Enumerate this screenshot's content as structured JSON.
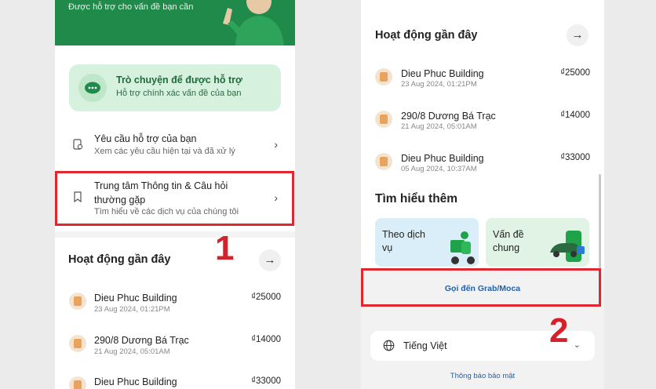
{
  "left": {
    "hero_subtitle": "Được hỗ trợ cho vấn đề bạn cần",
    "chat_card": {
      "title": "Trò chuyện để được hỗ trợ",
      "subtitle": "Hỗ trợ chính xác vấn đề của bạn"
    },
    "support_requests": {
      "title": "Yêu cầu hỗ trợ của bạn",
      "subtitle": "Xem các yêu cầu hiện tại và đã xử lý"
    },
    "help_center": {
      "title_line1": "Trung tâm Thông tin & Câu hỏi",
      "title_line2": "thường gặp",
      "subtitle": "Tìm hiểu về các dịch vụ của chúng tôi"
    },
    "step_number": "1",
    "recent_title": "Hoạt động gần đây",
    "activities": [
      {
        "name": "Dieu Phuc Building",
        "date": "23 Aug 2024, 01:21PM",
        "amount": "₫25000"
      },
      {
        "name": "290/8 Dương Bá Trạc",
        "date": "21 Aug 2024, 05:01AM",
        "amount": "₫14000"
      },
      {
        "name": "Dieu Phuc Building",
        "date": "",
        "amount": "₫33000"
      }
    ]
  },
  "right": {
    "recent_title": "Hoạt động gần đây",
    "activities": [
      {
        "name": "Dieu Phuc Building",
        "date": "23 Aug 2024, 01:21PM",
        "amount": "₫25000"
      },
      {
        "name": "290/8 Dương Bá Trạc",
        "date": "21 Aug 2024, 05:01AM",
        "amount": "₫14000"
      },
      {
        "name": "Dieu Phuc Building",
        "date": "05 Aug 2024, 10:37AM",
        "amount": "₫33000"
      }
    ],
    "learn_more_title": "Tìm hiểu thêm",
    "tiles": [
      {
        "label": "Theo dịch vụ"
      },
      {
        "label": "Vấn đề chung"
      }
    ],
    "call_link": "Gọi đến Grab/Moca",
    "step_number": "2",
    "language": "Tiếng Việt",
    "privacy_link": "Thông báo bảo mật"
  },
  "colors": {
    "brand_green": "#1f8a4a",
    "highlight_red": "#e0262e",
    "link_blue": "#2461a8"
  },
  "icons": [
    "chat-bubble-icon",
    "receipt-icon",
    "bookmark-icon",
    "chevron-right-icon",
    "arrow-right-icon",
    "building-icon",
    "globe-icon",
    "chevron-down-icon"
  ]
}
